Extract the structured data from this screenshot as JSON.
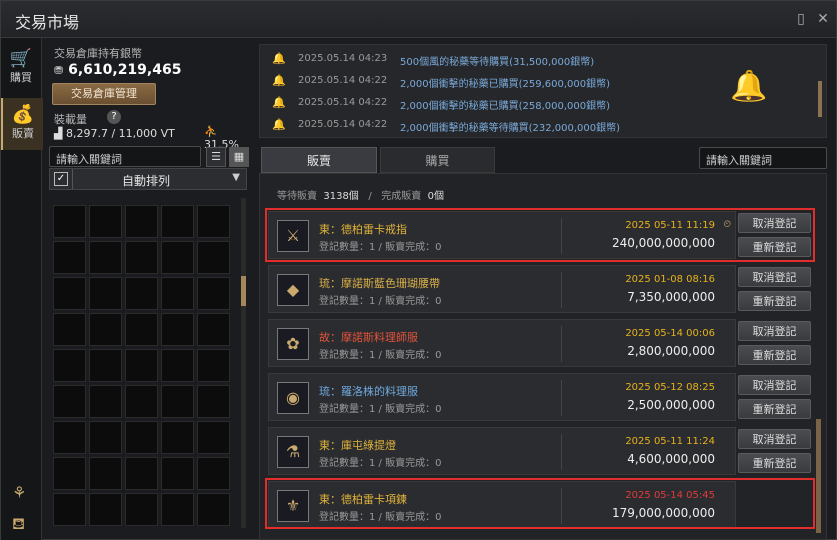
{
  "window": {
    "title": "交易市場"
  },
  "sidebar": {
    "items": [
      {
        "label": "購買",
        "icon": "cart-icon"
      },
      {
        "label": "販賣",
        "icon": "sell-bag-icon"
      }
    ]
  },
  "left": {
    "silver_label": "交易倉庫持有銀幣",
    "silver_value": "6,610,219,465",
    "manage_button": "交易倉庫管理",
    "weight_label": "裝載量",
    "weight_value": "8,297.7 / 11,000 VT",
    "weight_percent": "31.5%",
    "search_placeholder": "請輸入關鍵詞",
    "sort_label": "自動排列"
  },
  "notifications": [
    {
      "time": "2025.05.14 04:23",
      "message": "500個風的秘藥等待購買(31,500,000銀幣)"
    },
    {
      "time": "2025.05.14 04:22",
      "message": "2,000個衝擊的秘藥已購買(259,600,000銀幣)"
    },
    {
      "time": "2025.05.14 04:22",
      "message": "2,000個衝擊的秘藥已購買(258,000,000銀幣)"
    },
    {
      "time": "2025.05.14 04:22",
      "message": "2,000個衝擊的秘藥等待購買(232,000,000銀幣)"
    }
  ],
  "tabs": {
    "sell": "販賣",
    "buy": "購買",
    "search_placeholder": "請輸入關鍵詞"
  },
  "stats": {
    "waiting_label": "等待販賣",
    "waiting_value": "3138個",
    "sep": "/",
    "done_label": "完成販賣",
    "done_value": "0個"
  },
  "actions": {
    "cancel": "取消登記",
    "relist": "重新登記"
  },
  "items": [
    {
      "name": "東：德柏雷卡戒指",
      "name_color": "#e0b43a",
      "info": "登記數量：1 / 販賣完成：0",
      "date": "2025 05-11 11:19",
      "date_color": "#e6b21a",
      "price": "240,000,000,000"
    },
    {
      "name": "琉：摩諾斯藍色珊瑚腰帶",
      "name_color": "#d9b04a",
      "info": "登記數量：1 / 販賣完成：0",
      "date": "2025 01-08 08:16",
      "date_color": "#e6b21a",
      "price": "7,350,000,000"
    },
    {
      "name": "故：摩諾斯料理師服",
      "name_color": "#e0533a",
      "info": "登記數量：1 / 販賣完成：0",
      "date": "2025 05-14 00:06",
      "date_color": "#e6b21a",
      "price": "2,800,000,000"
    },
    {
      "name": "琉：羅洛株的料理服",
      "name_color": "#6fa8dc",
      "info": "登記數量：1 / 販賣完成：0",
      "date": "2025 05-12 08:25",
      "date_color": "#e6b21a",
      "price": "2,500,000,000"
    },
    {
      "name": "東：庫屯綠提燈",
      "name_color": "#e0b43a",
      "info": "登記數量：1 / 販賣完成：0",
      "date": "2025 05-11 11:24",
      "date_color": "#e6b21a",
      "price": "4,600,000,000"
    },
    {
      "name": "東：德柏雷卡項鍊",
      "name_color": "#e0b43a",
      "info": "登記數量：1 / 販賣完成：0",
      "date": "2025 05-14 05:45",
      "date_color": "#e23b3b",
      "price": "179,000,000,000"
    }
  ]
}
